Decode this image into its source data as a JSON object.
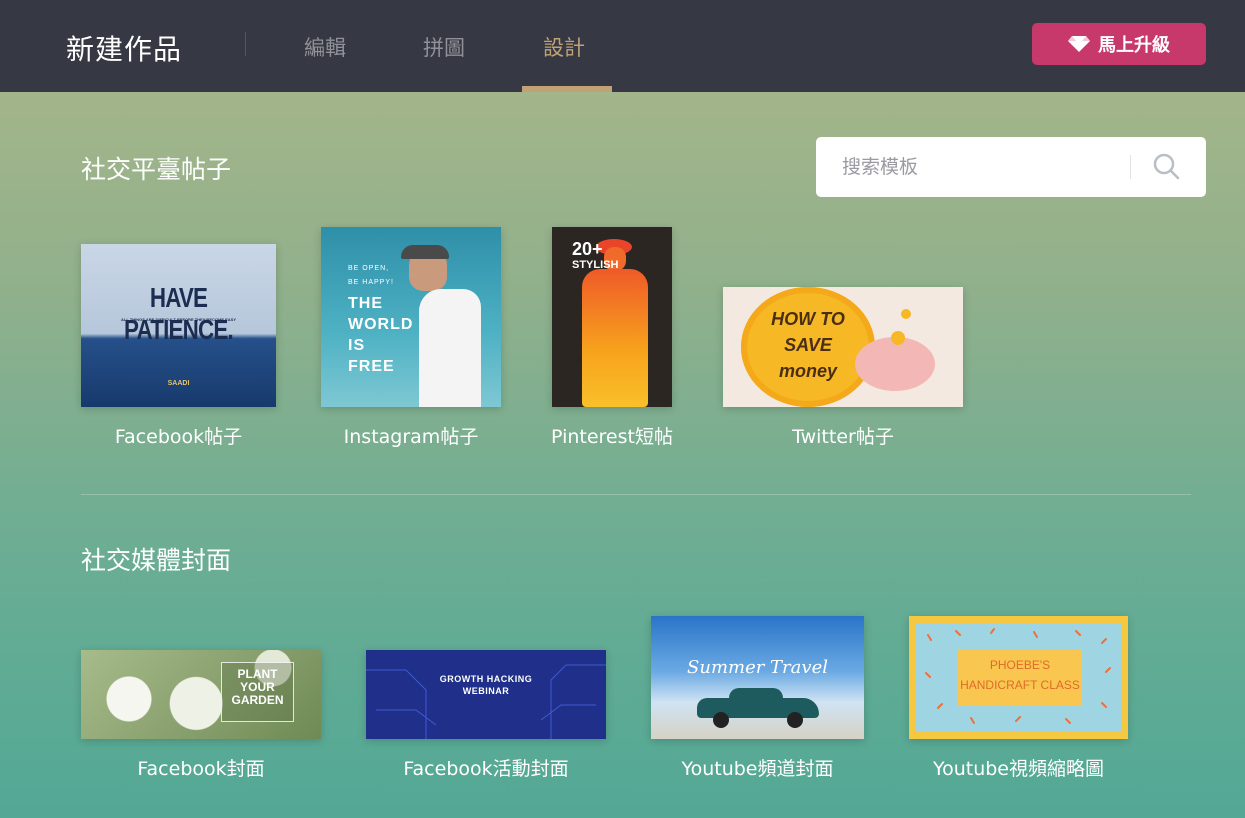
{
  "header": {
    "app_title": "新建作品",
    "tabs": [
      {
        "label": "編輯",
        "active": false
      },
      {
        "label": "拼圖",
        "active": false
      },
      {
        "label": "設計",
        "active": true
      }
    ],
    "upgrade_label": "馬上升級",
    "accent_color": "#c0a276",
    "upgrade_color": "#c7386b"
  },
  "search": {
    "placeholder": "搜索模板"
  },
  "sections": [
    {
      "title": "社交平臺帖子",
      "items": [
        {
          "label": "Facebook帖子",
          "thumb_text": [
            "HAVE PATIENCE.",
            "ALL THINGS ARE DIFFICULT BEFORE THEY BECOME EASY",
            "SAADI"
          ]
        },
        {
          "label": "Instagram帖子",
          "thumb_text": [
            "BE OPEN,",
            "BE HAPPY!",
            "THE",
            "WORLD",
            "IS",
            "FREE"
          ]
        },
        {
          "label": "Pinterest短帖",
          "thumb_text": [
            "20+",
            "STYLISH"
          ]
        },
        {
          "label": "Twitter帖子",
          "thumb_text": [
            "HOW TO",
            "SAVE",
            "money"
          ]
        }
      ]
    },
    {
      "title": "社交媒體封面",
      "items": [
        {
          "label": "Facebook封面",
          "thumb_text": [
            "PLANT",
            "YOUR",
            "GARDEN"
          ]
        },
        {
          "label": "Facebook活動封面",
          "thumb_text": [
            "GROWTH HACKING",
            "WEBINAR"
          ]
        },
        {
          "label": "Youtube頻道封面",
          "thumb_text": [
            "Summer Travel"
          ]
        },
        {
          "label": "Youtube視頻縮略圖",
          "thumb_text": [
            "PHOEBE'S",
            "HANDICRAFT CLASS"
          ]
        }
      ]
    }
  ]
}
